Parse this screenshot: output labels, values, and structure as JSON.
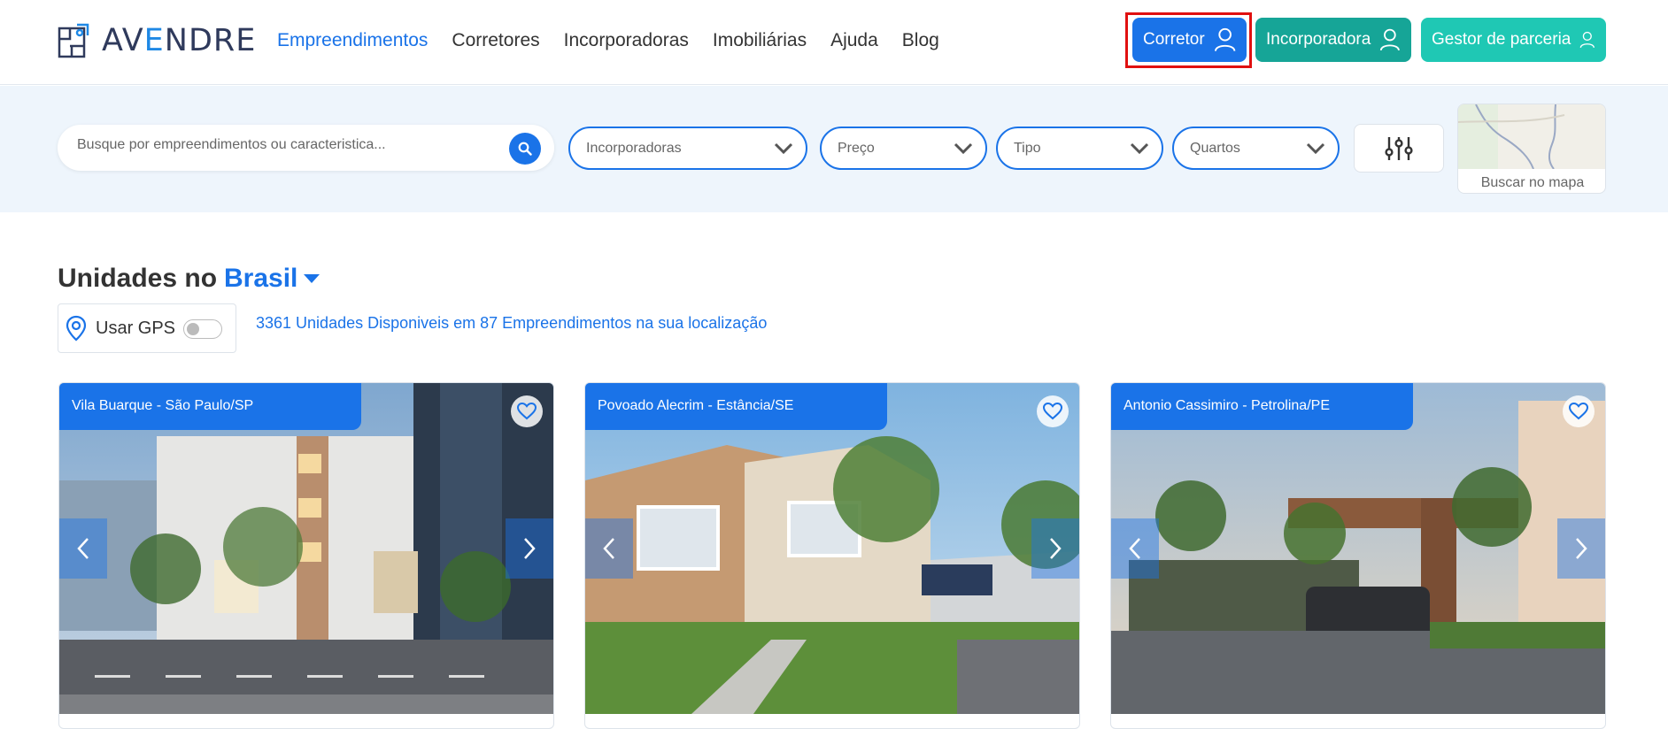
{
  "brand": {
    "name_pre": "AV",
    "name_e": "E",
    "name_post": "NDRE"
  },
  "nav": [
    {
      "label": "Empreendimentos",
      "active": true
    },
    {
      "label": "Corretores"
    },
    {
      "label": "Incorporadoras"
    },
    {
      "label": "Imobiliárias"
    },
    {
      "label": "Ajuda"
    },
    {
      "label": "Blog"
    }
  ],
  "header_buttons": {
    "corretor": "Corretor",
    "incorporadora": "Incorporadora",
    "gestor": "Gestor de parceria"
  },
  "search": {
    "placeholder": "Busque por empreendimentos ou caracteristica..."
  },
  "filters": {
    "incorporadoras": "Incorporadoras",
    "preco": "Preço",
    "tipo": "Tipo",
    "quartos": "Quartos",
    "map_label": "Buscar no mapa"
  },
  "section": {
    "title_prefix": "Unidades no",
    "location": "Brasil",
    "gps_label": "Usar GPS",
    "gps_enabled": false,
    "units_summary": "3361 Unidades Disponiveis em 87 Empreendimentos na sua localização"
  },
  "cards": [
    {
      "location": "Vila Buarque - São Paulo/SP"
    },
    {
      "location": "Povoado Alecrim - Estância/SE"
    },
    {
      "location": "Antonio Cassimiro - Petrolina/PE"
    }
  ],
  "colors": {
    "primary": "#1a73e8",
    "incorporadora_btn": "#16a597",
    "gestor_btn": "#1fc8b4",
    "band_bg": "#eef5fc",
    "highlight_frame": "#e01010"
  }
}
